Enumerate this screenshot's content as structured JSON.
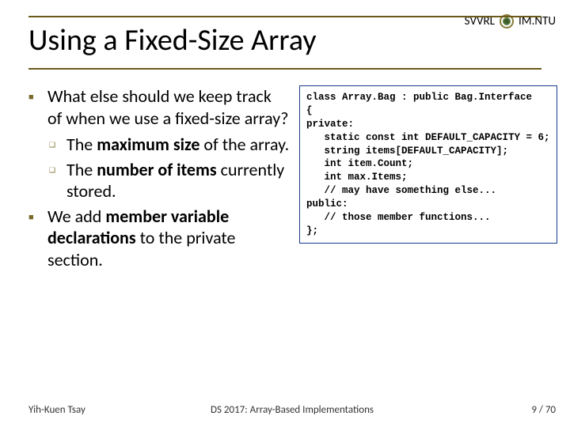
{
  "header": {
    "org": "SVVRL",
    "dept": "IM.NTU"
  },
  "title": "Using a Fixed-Size Array",
  "bullets": {
    "b1": {
      "pre": "What else should we keep track of when we use a fixed-size array?"
    },
    "b1a": {
      "pre": "The ",
      "bold": "maximum size",
      "post": " of the array."
    },
    "b1b": {
      "pre": "The ",
      "bold": "number of items",
      "post": " currently stored."
    },
    "b2": {
      "pre": "We add ",
      "bold": "member variable declarations",
      "post": " to the private section."
    }
  },
  "code": {
    "l1": "class Array.Bag : public Bag.Interface",
    "l2": "{",
    "l3": "private:",
    "l4": "   static const int DEFAULT_CAPACITY = 6;",
    "l5": "   string items[DEFAULT_CAPACITY];",
    "l6": "   int item.Count;",
    "l7": "   int max.Items;",
    "l8": "   // may have something else...",
    "l9": "public:",
    "l10": "   // those member functions...",
    "l11": "};"
  },
  "footer": {
    "author": "Yih-Kuen Tsay",
    "course": "DS 2017: Array-Based Implementations",
    "page": "9 / 70"
  }
}
